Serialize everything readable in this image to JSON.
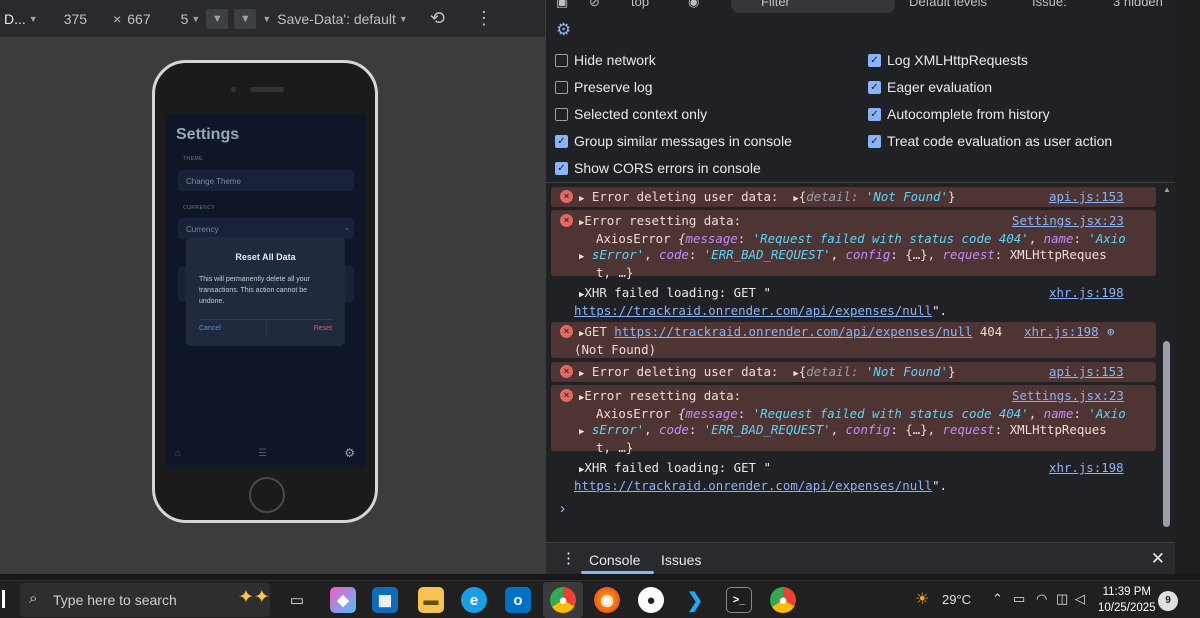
{
  "device_toolbar": {
    "device": "D...",
    "width": "375",
    "times": "×",
    "height": "667",
    "zoom": "5",
    "network": "Save-Data': default"
  },
  "phone_app": {
    "title": "Settings",
    "theme_label": "THEME",
    "theme_value": "Change Theme",
    "currency_label": "CURRENCY",
    "currency_value": "Currency",
    "dialog": {
      "title": "Reset All Data",
      "body": "This will permanently delete all your transactions. This action cannot be undone.",
      "cancel": "Cancel",
      "confirm": "Reset"
    }
  },
  "console_toolbar": {
    "context": "top",
    "filter_placeholder": "Filter",
    "levels": "Default levels",
    "issues": "Issue:",
    "hidden": "3 hidden"
  },
  "settings": {
    "left": [
      {
        "label": "Hide network",
        "checked": false
      },
      {
        "label": "Preserve log",
        "checked": false
      },
      {
        "label": "Selected context only",
        "checked": false
      },
      {
        "label": "Group similar messages in console",
        "checked": true
      },
      {
        "label": "Show CORS errors in console",
        "checked": true
      }
    ],
    "right": [
      {
        "label": "Log XMLHttpRequests",
        "checked": true
      },
      {
        "label": "Eager evaluation",
        "checked": true
      },
      {
        "label": "Autocomplete from history",
        "checked": true
      },
      {
        "label": "Treat code evaluation as user action",
        "checked": true
      }
    ]
  },
  "console": {
    "msg1": {
      "text": "Error deleting user data:",
      "detail_key": "detail",
      "detail_val": "'Not Found'",
      "src": "api.js:153"
    },
    "msg2": {
      "text": "Error resetting data:",
      "src": "Settings.jsx:23",
      "err_name": "AxiosError",
      "message_key": "message",
      "message_val": "'Request failed with status code 404'",
      "name_key": "name",
      "name_val_1": "'Axio",
      "name_val_2": "sError'",
      "code_key": "code",
      "code_val": "'ERR_BAD_REQUEST'",
      "config_key": "config",
      "config_val": "{…}",
      "request_key": "request",
      "request_val_1": "XMLHttpReques",
      "request_val_2": "t, …}"
    },
    "msg3": {
      "text": "XHR failed loading: GET \"",
      "url": "https://trackraid.onrender.com/api/expenses/null",
      "tail": "\".",
      "src": "xhr.js:198"
    },
    "msg4": {
      "text": "GET",
      "url": "https://trackraid.onrender.com/api/expenses/null",
      "status": "404",
      "status2": "(Not Found)",
      "src": "xhr.js:198"
    },
    "prompt": "›"
  },
  "drawer": {
    "tab_console": "Console",
    "tab_issues": "Issues"
  },
  "taskbar": {
    "search_placeholder": "Type here to search",
    "weather": "29°C",
    "time": "11:39 PM",
    "date": "10/25/2025",
    "notifications": "9"
  },
  "colors": {
    "accent": "#8ab4f8",
    "error_bg": "#4e3534",
    "error_icon": "#e46962"
  }
}
